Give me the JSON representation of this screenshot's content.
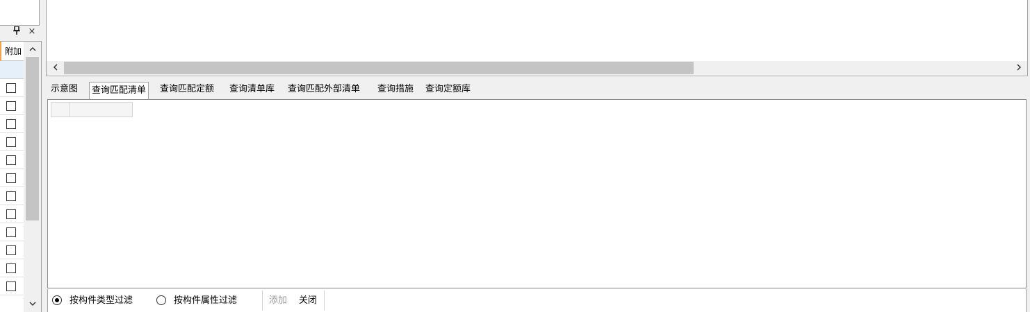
{
  "left_panel": {
    "column_header": "附加",
    "checkbox_rows": 12
  },
  "tabs": [
    {
      "label": "示意图",
      "active": false
    },
    {
      "label": "查询匹配清单",
      "active": true
    },
    {
      "label": "查询匹配定额",
      "active": false
    },
    {
      "label": "查询清单库",
      "active": false
    },
    {
      "label": "查询匹配外部清单",
      "active": false
    },
    {
      "label": "查询措施",
      "active": false
    },
    {
      "label": "查询定额库",
      "active": false
    }
  ],
  "filter_bar": {
    "option_type": "按构件类型过滤",
    "option_attr": "按构件属性过滤",
    "selected": "按构件类型过滤",
    "add_label": "添加",
    "close_label": "关闭"
  },
  "icons": {
    "pin": "pin-icon",
    "close": "close-icon",
    "scroll_up": "chevron-up-icon",
    "scroll_down": "chevron-down-icon",
    "scroll_left": "chevron-left-icon",
    "scroll_right": "chevron-right-icon"
  },
  "colors": {
    "header_accent": "#f3a34a",
    "selected_row": "#e6f0fa"
  }
}
